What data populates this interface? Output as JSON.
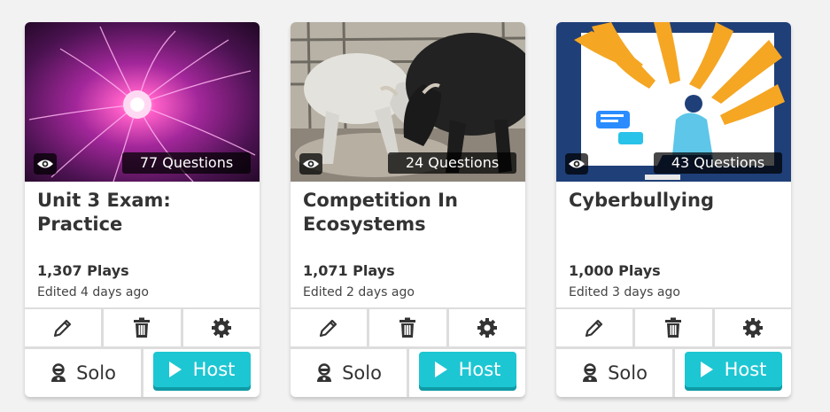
{
  "cards": [
    {
      "question_count": "77 Questions",
      "title": "Unit 3 Exam: Practice",
      "plays": "1,307 Plays",
      "edited": "Edited 4 days ago",
      "solo_label": "Solo",
      "host_label": "Host"
    },
    {
      "question_count": "24 Questions",
      "title": "Competition In Ecosystems",
      "plays": "1,071 Plays",
      "edited": "Edited 2 days ago",
      "solo_label": "Solo",
      "host_label": "Host"
    },
    {
      "question_count": "43 Questions",
      "title": "Cyberbullying",
      "plays": "1,000 Plays",
      "edited": "Edited 3 days ago",
      "solo_label": "Solo",
      "host_label": "Host"
    }
  ],
  "icons": {
    "preview": "eye-icon",
    "edit": "pencil-icon",
    "delete": "trash-icon",
    "settings": "gear-icon",
    "solo": "player-icon",
    "host": "play-icon"
  },
  "colors": {
    "accent": "#1dc6d3",
    "accent_shadow": "#0f9aa5",
    "text": "#333333",
    "page_bg": "#f2f2f2"
  }
}
